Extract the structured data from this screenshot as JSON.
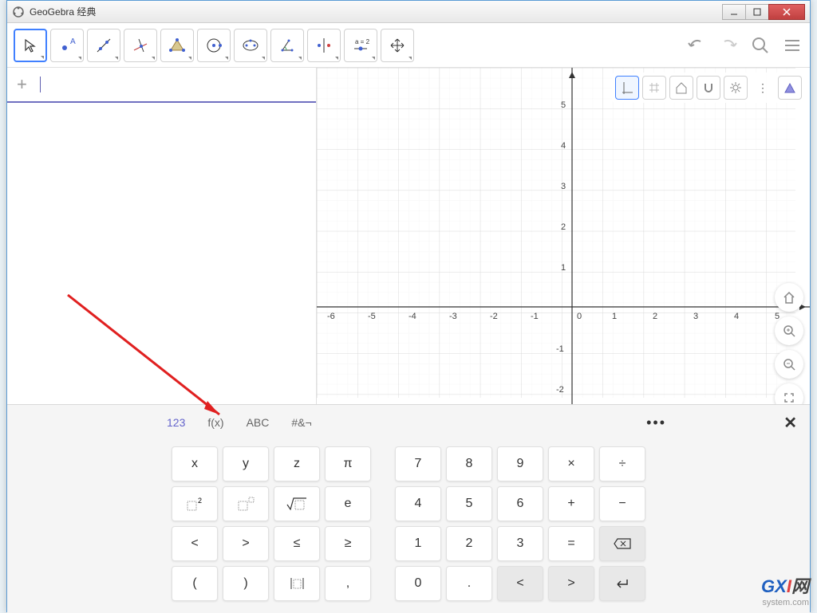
{
  "window": {
    "title": "GeoGebra 经典"
  },
  "toolbar": {
    "slider_label": "a = 2",
    "tools": [
      "move",
      "point",
      "line",
      "perpendicular",
      "polygon",
      "circle",
      "ellipse",
      "angle",
      "reflect",
      "slider",
      "move-view"
    ]
  },
  "graphics": {
    "x_ticks": [
      "-6",
      "-5",
      "-4",
      "-3",
      "-2",
      "-1",
      "0",
      "1",
      "2",
      "3",
      "4",
      "5"
    ],
    "y_ticks_pos": [
      "1",
      "2",
      "3",
      "4",
      "5"
    ],
    "y_ticks_neg": [
      "-1",
      "-2"
    ]
  },
  "keyboard": {
    "tabs": {
      "numeric": "123",
      "fx": "f(x)",
      "abc": "ABC",
      "special": "#&¬"
    },
    "row1_left": [
      "x",
      "y",
      "z",
      "π"
    ],
    "row1_right": [
      "7",
      "8",
      "9",
      "×",
      "÷"
    ],
    "row2_left_labels": [
      "sq",
      "exp",
      "sqrt",
      "e"
    ],
    "row2_left_display": {
      "e": "e",
      "sqrt": "√"
    },
    "row2_right": [
      "4",
      "5",
      "6",
      "+",
      "−"
    ],
    "row3_left": [
      "<",
      ">",
      "≤",
      "≥"
    ],
    "row3_right": [
      "1",
      "2",
      "3",
      "=",
      "⌫"
    ],
    "row4_left": [
      "(",
      ")",
      "abs",
      ","
    ],
    "row4_right": [
      "0",
      ".",
      "<",
      ">",
      "↵"
    ]
  },
  "watermark": {
    "line1_a": "G",
    "line1_b": "X",
    "line1_c": "I",
    "line1_d": "网",
    "line2": "system.com"
  }
}
